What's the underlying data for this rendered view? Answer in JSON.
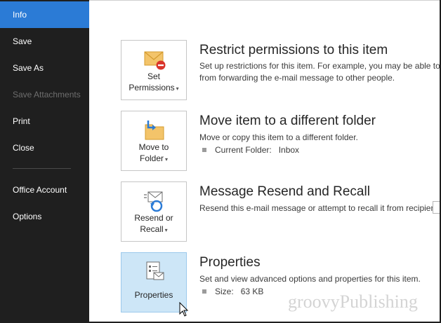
{
  "sidebar": {
    "items": [
      {
        "label": "Info",
        "state": "active"
      },
      {
        "label": "Save",
        "state": "normal"
      },
      {
        "label": "Save As",
        "state": "normal"
      },
      {
        "label": "Save Attachments",
        "state": "disabled"
      },
      {
        "label": "Print",
        "state": "normal"
      },
      {
        "label": "Close",
        "state": "normal"
      },
      {
        "label": "Office Account",
        "state": "normal"
      },
      {
        "label": "Options",
        "state": "normal"
      }
    ]
  },
  "sections": [
    {
      "button_line1": "Set",
      "button_line2": "Permissions",
      "icon": "envelope-restrict-icon",
      "title": "Restrict permissions to this item",
      "desc_line1": "Set up restrictions for this item. For example, you may be able to",
      "desc_line2": "from forwarding the e-mail message to other people."
    },
    {
      "button_line1": "Move to",
      "button_line2": "Folder",
      "icon": "folder-move-icon",
      "title": "Move item to a different folder",
      "desc_line1": "Move or copy this item to a different folder.",
      "bullet_label": "Current Folder:",
      "bullet_value": "Inbox"
    },
    {
      "button_line1": "Resend or",
      "button_line2": "Recall",
      "icon": "resend-recall-icon",
      "title": "Message Resend and Recall",
      "desc_line1": "Resend this e-mail message or attempt to recall it from recipients"
    },
    {
      "button_line1": "Properties",
      "icon": "properties-icon",
      "title": "Properties",
      "desc_line1": "Set and view advanced options and properties for this item.",
      "bullet_label": "Size:",
      "bullet_value": "63 KB"
    }
  ],
  "watermark": "groovyPublishing",
  "colors": {
    "sidebar_bg": "#1f1f1f",
    "active_item": "#2b7bd6",
    "hover_tile": "#cde6f7"
  }
}
